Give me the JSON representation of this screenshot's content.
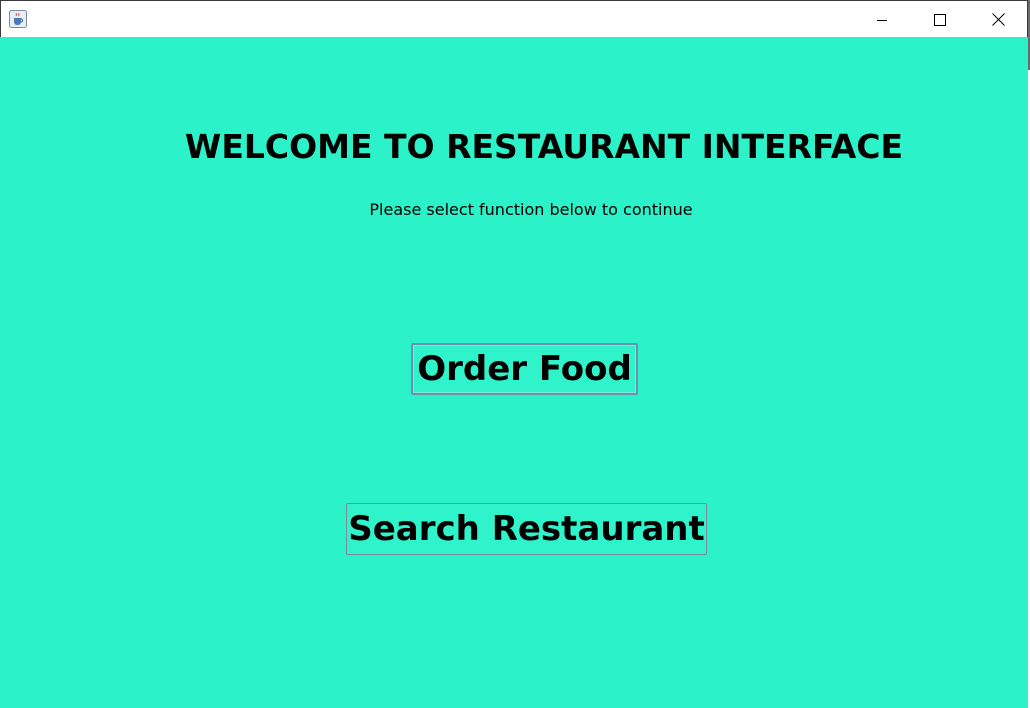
{
  "window": {
    "title": "",
    "controls": {
      "minimize_icon": "minimize-icon",
      "maximize_icon": "maximize-icon",
      "close_icon": "close-icon"
    },
    "app_icon": "java-coffee-icon"
  },
  "main": {
    "heading": "WELCOME TO RESTAURANT INTERFACE",
    "subtext": "Please select function below to continue",
    "buttons": {
      "order_food": "Order Food",
      "search_restaurant": "Search Restaurant"
    }
  },
  "colors": {
    "background": "#2bf2c8",
    "text": "#000000",
    "button_border": "#7a8a9a"
  }
}
